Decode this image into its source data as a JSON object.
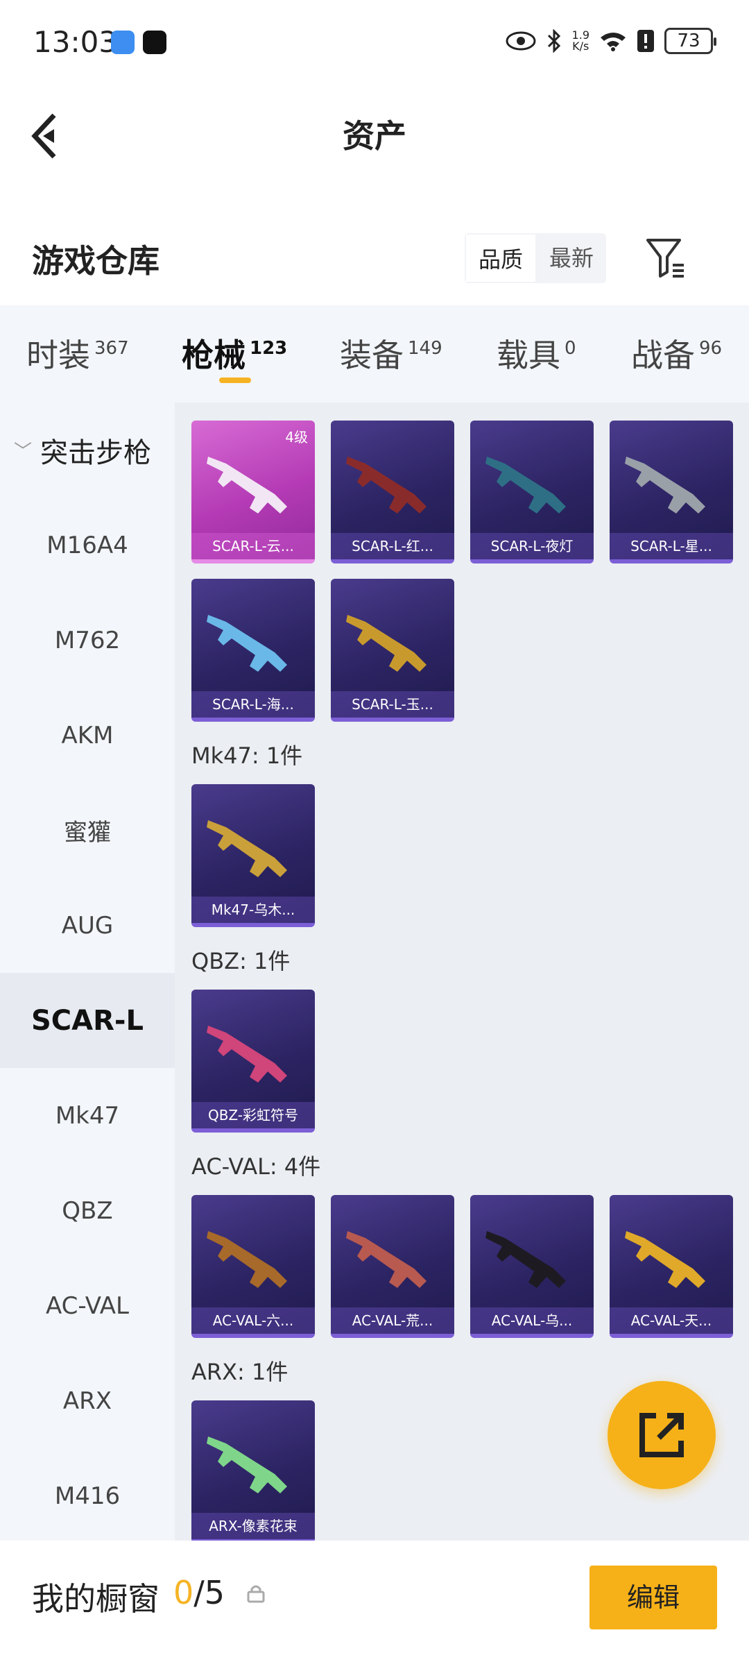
{
  "status_bar": {
    "time": "13:03",
    "speed_top": "1.9",
    "speed_unit": "K/s",
    "battery": "73"
  },
  "header": {
    "title": "资产"
  },
  "warehouse": {
    "title": "游戏仓库",
    "sort_quality": "品质",
    "sort_latest": "最新"
  },
  "tabs": [
    {
      "label": "时装",
      "count": "367"
    },
    {
      "label": "枪械",
      "count": "123"
    },
    {
      "label": "装备",
      "count": "149"
    },
    {
      "label": "载具",
      "count": "0"
    },
    {
      "label": "战备",
      "count": "96"
    }
  ],
  "side": {
    "group": "突击步枪",
    "items": [
      "M16A4",
      "M762",
      "AKM",
      "蜜獾",
      "AUG",
      "SCAR-L",
      "Mk47",
      "QBZ",
      "AC-VAL",
      "ARX",
      "M416"
    ],
    "selected": "SCAR-L"
  },
  "content": {
    "scar_cards": [
      {
        "label": "SCAR-L-云...",
        "level": "4级"
      },
      {
        "label": "SCAR-L-红..."
      },
      {
        "label": "SCAR-L-夜灯"
      },
      {
        "label": "SCAR-L-星..."
      },
      {
        "label": "SCAR-L-海..."
      },
      {
        "label": "SCAR-L-玉..."
      }
    ],
    "mk47_head": "Mk47: 1件",
    "mk47_cards": [
      {
        "label": "Mk47-乌木..."
      }
    ],
    "qbz_head": "QBZ: 1件",
    "qbz_cards": [
      {
        "label": "QBZ-彩虹符号"
      }
    ],
    "acval_head": "AC-VAL: 4件",
    "acval_cards": [
      {
        "label": "AC-VAL-六..."
      },
      {
        "label": "AC-VAL-荒..."
      },
      {
        "label": "AC-VAL-乌..."
      },
      {
        "label": "AC-VAL-天..."
      }
    ],
    "arx_head": "ARX: 1件",
    "arx_cards": [
      {
        "label": "ARX-像素花束"
      }
    ]
  },
  "bottom": {
    "title": "我的橱窗",
    "current": "0",
    "total": "/5",
    "edit_label": "编辑"
  },
  "colors": {
    "accent": "#f6b118",
    "card_purple": "#2c2463",
    "card_pink": "#b43bb5"
  }
}
